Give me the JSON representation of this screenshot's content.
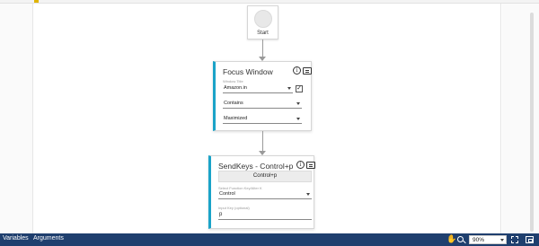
{
  "start": {
    "label": "Start"
  },
  "focus_window": {
    "title": "Focus Window",
    "window_title_label": "Window Title",
    "window_title_value": "Amazon.in",
    "window_title_checked": true,
    "match_value": "Contains",
    "state_value": "Maximized"
  },
  "send_keys": {
    "title": "SendKeys - Control+p",
    "keys_display": "Control+p",
    "modifier_label": "Select Function Key/Alter K",
    "modifier_value": "Control",
    "input_key_label": "Input Key (optional)",
    "input_key_value": "p"
  },
  "statusbar": {
    "variables_label": "Variables",
    "arguments_label": "Arguments",
    "zoom_value": "90%",
    "hand_icon": "pan-hand-icon",
    "zoom_icon": "zoom-magnifier-icon",
    "fit_icon": "fit-to-screen-icon",
    "overview_icon": "overview-icon"
  },
  "colors": {
    "accent": "#1aa3c8",
    "statusbar_bg": "#1f3f6e",
    "connector": "#9a9a9a"
  }
}
